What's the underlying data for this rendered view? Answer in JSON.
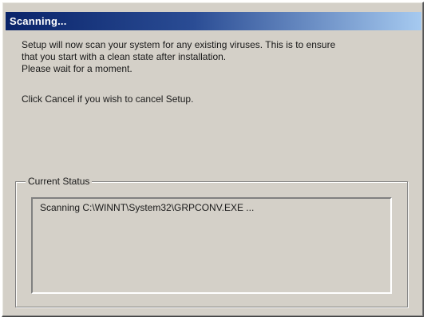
{
  "window": {
    "title": "Scanning..."
  },
  "message": {
    "line1": "Setup will now scan your system for any existing viruses. This is to ensure",
    "line2": "that you start with a clean state after installation.",
    "line3": "Please wait for a moment.",
    "line4": "Click Cancel if you wish to cancel Setup."
  },
  "status_group": {
    "label": "Current Status",
    "status_text": "Scanning C:\\WINNT\\System32\\GRPCONV.EXE ..."
  },
  "colors": {
    "title_gradient_start": "#0a246a",
    "title_gradient_end": "#a6caf0",
    "dialog_face": "#d4d0c8"
  }
}
